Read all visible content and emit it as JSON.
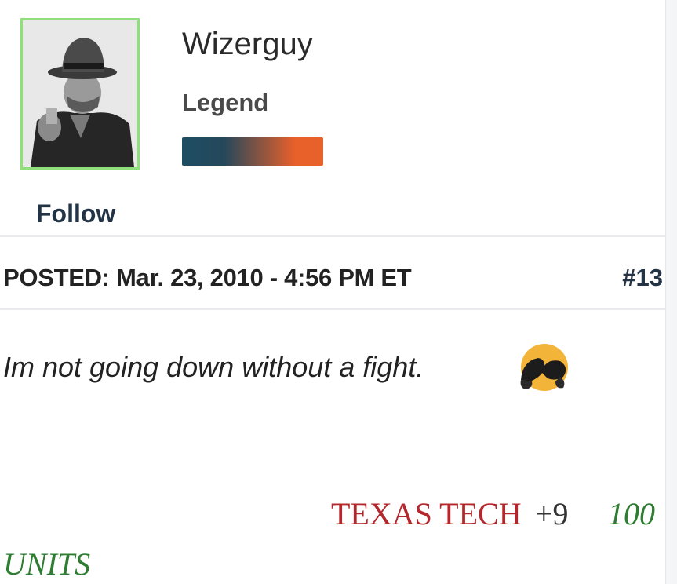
{
  "profile": {
    "username": "Wizerguy",
    "rank": "Legend",
    "follow_label": "Follow",
    "rank_bar_colors": [
      "#1e4d63",
      "#e8602a"
    ],
    "avatar_icon": "user-avatar-photo"
  },
  "post": {
    "posted": "POSTED: Mar. 23, 2010 - 4:56 PM ET",
    "number": "#13",
    "text": "Im not going down without a fight.",
    "emoji_icon": "boxing-emoji-icon",
    "pick": {
      "team": "TEXAS TECH",
      "line": "+9",
      "units_a": "100",
      "units_b": "UNITS"
    }
  },
  "colors": {
    "avatar_border": "#8fe07a",
    "team_red": "#b4282d",
    "units_green": "#2e7d32",
    "link_dark": "#243447"
  }
}
